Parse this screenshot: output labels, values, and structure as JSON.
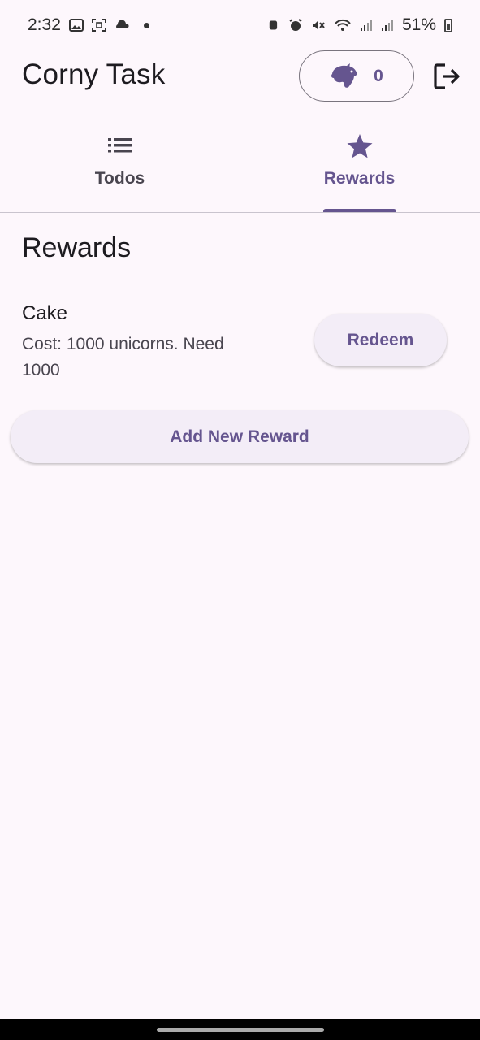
{
  "status_bar": {
    "time": "2:32",
    "battery": "51%",
    "icons": [
      "gallery-icon",
      "screenshot-icon",
      "cloud-icon",
      "notification-dot",
      "bixby-icon",
      "alarm-icon",
      "mute-icon",
      "wifi-icon",
      "signal-icon",
      "signal-roaming-icon",
      "battery-icon"
    ]
  },
  "app_bar": {
    "title": "Corny Task",
    "unicorn_count": "0",
    "accent_color": "#65558F"
  },
  "tabs": [
    {
      "label": "Todos",
      "icon": "list-icon",
      "selected": false
    },
    {
      "label": "Rewards",
      "icon": "star-icon",
      "selected": true
    }
  ],
  "rewards": {
    "title": "Rewards",
    "items": [
      {
        "name": "Cake",
        "description": "Cost: 1000 unicorns. Need 1000",
        "action_label": "Redeem"
      }
    ],
    "add_label": "Add New Reward"
  }
}
